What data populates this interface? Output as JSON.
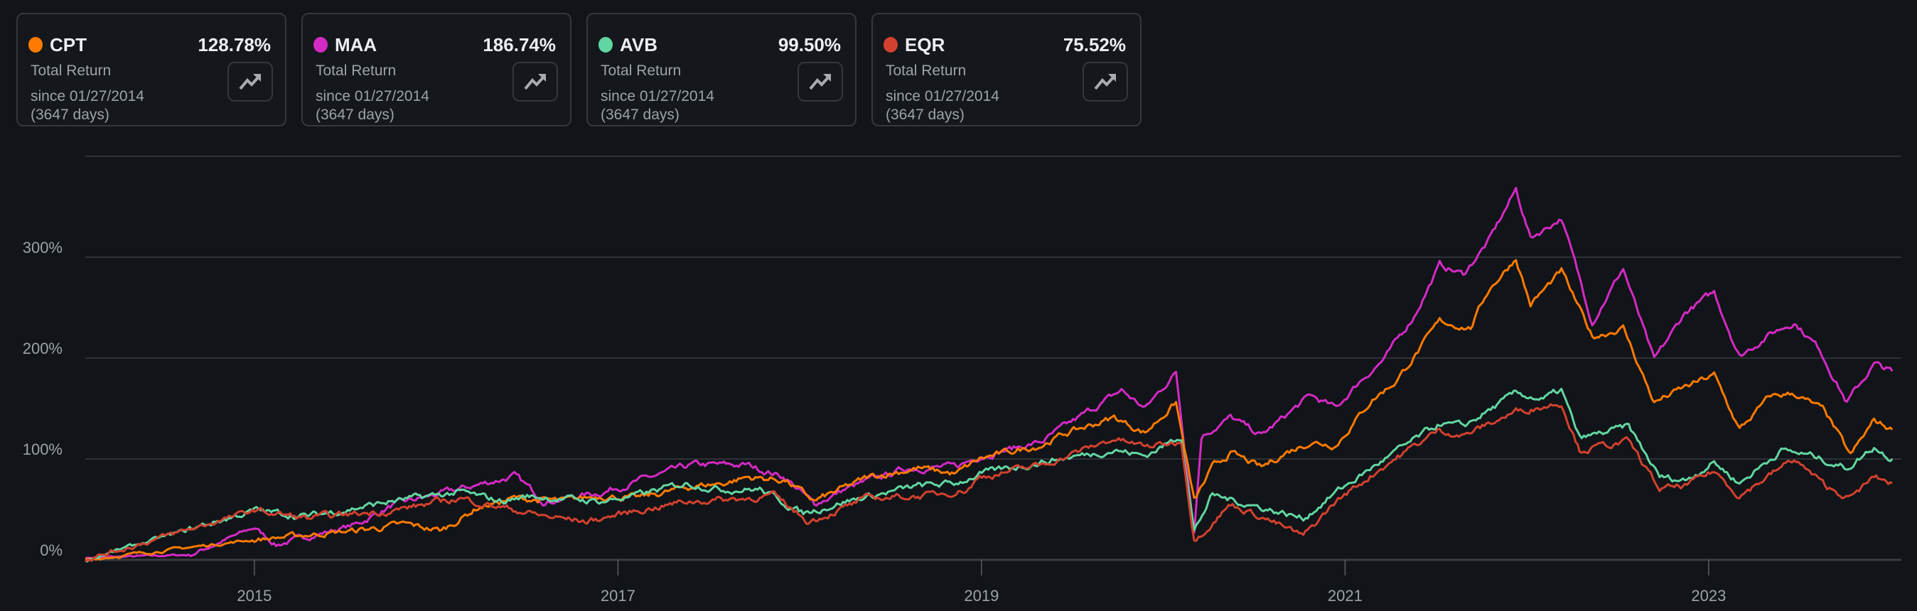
{
  "cards": [
    {
      "ticker": "CPT",
      "value": "128.78%",
      "label": "Total Return",
      "since": "since 01/27/2014",
      "days": "(3647 days)",
      "color": "#ff7a00"
    },
    {
      "ticker": "MAA",
      "value": "186.74%",
      "label": "Total Return",
      "since": "since 01/27/2014",
      "days": "(3647 days)",
      "color": "#d42ac4"
    },
    {
      "ticker": "AVB",
      "value": "99.50%",
      "label": "Total Return",
      "since": "since 01/27/2014",
      "days": "(3647 days)",
      "color": "#62d6a2"
    },
    {
      "ticker": "EQR",
      "value": "75.52%",
      "label": "Total Return",
      "since": "since 01/27/2014",
      "days": "(3647 days)",
      "color": "#d2412f"
    }
  ],
  "chart_data": {
    "type": "line",
    "title": "",
    "xlabel": "",
    "ylabel": "",
    "xlim": [
      2014.07,
      2024.06
    ],
    "ylim": [
      0,
      400
    ],
    "yticks": [
      0,
      100,
      200,
      300,
      400
    ],
    "ytick_labels": [
      "0%",
      "100%",
      "200%",
      "300%",
      ""
    ],
    "xticks": [
      2015,
      2017,
      2019,
      2021,
      2023
    ],
    "xtick_labels": [
      "2015",
      "2017",
      "2019",
      "2021",
      "2023"
    ],
    "grid": true,
    "legend": "none",
    "series": [
      {
        "name": "MAA",
        "color": "#d42ac4",
        "points": [
          [
            2014.07,
            2
          ],
          [
            2014.65,
            5
          ],
          [
            2015.0,
            32
          ],
          [
            2015.12,
            15
          ],
          [
            2015.56,
            35
          ],
          [
            2015.76,
            54
          ],
          [
            2016.13,
            70
          ],
          [
            2016.43,
            83
          ],
          [
            2016.6,
            58
          ],
          [
            2016.91,
            67
          ],
          [
            2017.11,
            78
          ],
          [
            2017.41,
            94
          ],
          [
            2017.71,
            94
          ],
          [
            2017.92,
            82
          ],
          [
            2018.08,
            55
          ],
          [
            2018.25,
            70
          ],
          [
            2018.59,
            91
          ],
          [
            2018.86,
            92
          ],
          [
            2018.99,
            103
          ],
          [
            2019.33,
            117
          ],
          [
            2019.77,
            168
          ],
          [
            2019.9,
            150
          ],
          [
            2020.07,
            186
          ],
          [
            2020.17,
            29
          ],
          [
            2020.21,
            123
          ],
          [
            2020.37,
            141
          ],
          [
            2020.54,
            123
          ],
          [
            2020.81,
            163
          ],
          [
            2020.95,
            150
          ],
          [
            2021.08,
            177
          ],
          [
            2021.22,
            200
          ],
          [
            2021.38,
            242
          ],
          [
            2021.52,
            292
          ],
          [
            2021.65,
            283
          ],
          [
            2021.79,
            316
          ],
          [
            2021.94,
            367
          ],
          [
            2022.02,
            319
          ],
          [
            2022.19,
            339
          ],
          [
            2022.36,
            236
          ],
          [
            2022.53,
            289
          ],
          [
            2022.7,
            197
          ],
          [
            2022.87,
            245
          ],
          [
            2023.03,
            265
          ],
          [
            2023.17,
            202
          ],
          [
            2023.34,
            224
          ],
          [
            2023.47,
            236
          ],
          [
            2023.61,
            209
          ],
          [
            2023.76,
            156
          ],
          [
            2023.91,
            194
          ],
          [
            2024.01,
            187
          ]
        ]
      },
      {
        "name": "CPT",
        "color": "#ff7a00",
        "points": [
          [
            2014.07,
            0
          ],
          [
            2015.0,
            20
          ],
          [
            2015.56,
            29
          ],
          [
            2015.83,
            35
          ],
          [
            2016.03,
            29
          ],
          [
            2016.23,
            52
          ],
          [
            2016.43,
            61
          ],
          [
            2016.7,
            58
          ],
          [
            2016.91,
            64
          ],
          [
            2017.11,
            61
          ],
          [
            2017.41,
            73
          ],
          [
            2017.58,
            76
          ],
          [
            2017.71,
            82
          ],
          [
            2017.92,
            79
          ],
          [
            2018.08,
            58
          ],
          [
            2018.38,
            82
          ],
          [
            2018.65,
            91
          ],
          [
            2018.86,
            85
          ],
          [
            2018.99,
            100
          ],
          [
            2019.33,
            114
          ],
          [
            2019.46,
            125
          ],
          [
            2019.73,
            141
          ],
          [
            2019.9,
            126
          ],
          [
            2020.07,
            156
          ],
          [
            2020.17,
            58
          ],
          [
            2020.27,
            91
          ],
          [
            2020.37,
            106
          ],
          [
            2020.54,
            91
          ],
          [
            2020.67,
            106
          ],
          [
            2020.81,
            117
          ],
          [
            2020.95,
            114
          ],
          [
            2021.15,
            159
          ],
          [
            2021.28,
            177
          ],
          [
            2021.52,
            236
          ],
          [
            2021.69,
            230
          ],
          [
            2021.79,
            268
          ],
          [
            2021.94,
            299
          ],
          [
            2022.02,
            253
          ],
          [
            2022.19,
            286
          ],
          [
            2022.36,
            221
          ],
          [
            2022.53,
            230
          ],
          [
            2022.7,
            156
          ],
          [
            2022.87,
            171
          ],
          [
            2023.03,
            183
          ],
          [
            2023.17,
            129
          ],
          [
            2023.34,
            162
          ],
          [
            2023.47,
            165
          ],
          [
            2023.64,
            147
          ],
          [
            2023.78,
            103
          ],
          [
            2023.91,
            138
          ],
          [
            2024.01,
            129
          ]
        ]
      },
      {
        "name": "AVB",
        "color": "#62d6a2",
        "points": [
          [
            2014.07,
            0
          ],
          [
            2014.62,
            29
          ],
          [
            2015.0,
            49
          ],
          [
            2015.29,
            43
          ],
          [
            2015.76,
            58
          ],
          [
            2016.13,
            67
          ],
          [
            2016.36,
            58
          ],
          [
            2016.5,
            63
          ],
          [
            2016.91,
            58
          ],
          [
            2017.11,
            64
          ],
          [
            2017.38,
            76
          ],
          [
            2017.58,
            70
          ],
          [
            2017.78,
            70
          ],
          [
            2018.02,
            46
          ],
          [
            2018.25,
            58
          ],
          [
            2018.65,
            73
          ],
          [
            2018.86,
            76
          ],
          [
            2018.99,
            85
          ],
          [
            2019.33,
            97
          ],
          [
            2019.73,
            109
          ],
          [
            2019.9,
            103
          ],
          [
            2020.1,
            123
          ],
          [
            2020.17,
            29
          ],
          [
            2020.27,
            64
          ],
          [
            2020.54,
            52
          ],
          [
            2020.77,
            41
          ],
          [
            2020.95,
            67
          ],
          [
            2021.22,
            100
          ],
          [
            2021.52,
            135
          ],
          [
            2021.65,
            132
          ],
          [
            2021.94,
            165
          ],
          [
            2022.09,
            159
          ],
          [
            2022.19,
            168
          ],
          [
            2022.29,
            120
          ],
          [
            2022.56,
            132
          ],
          [
            2022.73,
            82
          ],
          [
            2022.87,
            79
          ],
          [
            2023.03,
            97
          ],
          [
            2023.17,
            76
          ],
          [
            2023.4,
            109
          ],
          [
            2023.57,
            103
          ],
          [
            2023.76,
            91
          ],
          [
            2023.91,
            112
          ],
          [
            2024.01,
            100
          ]
        ]
      },
      {
        "name": "EQR",
        "color": "#d2412f",
        "points": [
          [
            2014.07,
            0
          ],
          [
            2015.0,
            49
          ],
          [
            2015.29,
            41
          ],
          [
            2015.76,
            49
          ],
          [
            2016.13,
            61
          ],
          [
            2016.6,
            43
          ],
          [
            2016.83,
            38
          ],
          [
            2017.11,
            49
          ],
          [
            2017.38,
            58
          ],
          [
            2017.71,
            61
          ],
          [
            2017.85,
            64
          ],
          [
            2018.05,
            38
          ],
          [
            2018.38,
            61
          ],
          [
            2018.72,
            64
          ],
          [
            2018.92,
            70
          ],
          [
            2018.99,
            82
          ],
          [
            2019.33,
            94
          ],
          [
            2019.73,
            120
          ],
          [
            2019.9,
            112
          ],
          [
            2020.1,
            117
          ],
          [
            2020.17,
            20
          ],
          [
            2020.37,
            55
          ],
          [
            2020.54,
            43
          ],
          [
            2020.77,
            23
          ],
          [
            2020.95,
            58
          ],
          [
            2021.22,
            94
          ],
          [
            2021.52,
            129
          ],
          [
            2021.65,
            123
          ],
          [
            2021.94,
            147
          ],
          [
            2022.19,
            156
          ],
          [
            2022.29,
            109
          ],
          [
            2022.56,
            117
          ],
          [
            2022.73,
            70
          ],
          [
            2022.87,
            73
          ],
          [
            2023.03,
            88
          ],
          [
            2023.17,
            64
          ],
          [
            2023.47,
            100
          ],
          [
            2023.64,
            73
          ],
          [
            2023.78,
            61
          ],
          [
            2023.91,
            82
          ],
          [
            2024.01,
            76
          ]
        ]
      }
    ]
  }
}
